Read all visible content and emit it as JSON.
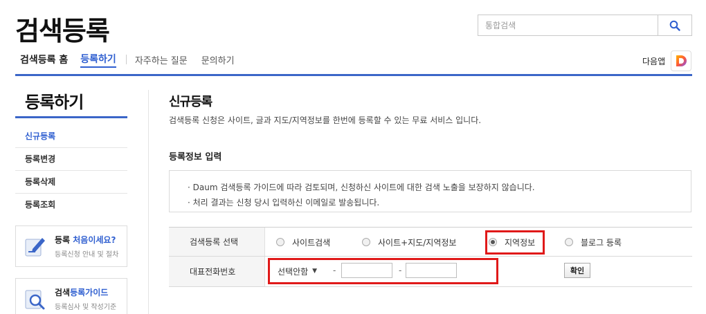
{
  "header": {
    "logo": "검색등록",
    "search_placeholder": "통합검색"
  },
  "gnb": {
    "home": "검색등록 홈",
    "active": "등록하기",
    "items": [
      "자주하는 질문",
      "문의하기"
    ]
  },
  "daum_app": {
    "label": "다음앱"
  },
  "sidebar": {
    "title": "등록하기",
    "items": [
      {
        "label": "신규등록"
      },
      {
        "label": "등록변경"
      },
      {
        "label": "등록삭제"
      },
      {
        "label": "등록조회"
      }
    ],
    "banners": [
      {
        "title_plain": "등록 ",
        "title_highlight": "처음이세요?",
        "desc": "등록신청 안내 및 절차"
      },
      {
        "title_plain": "검색",
        "title_highlight": "등록가이드",
        "desc": "등록심사 및 작성기준"
      }
    ]
  },
  "main": {
    "title": "신규등록",
    "description": "검색등록 신청은 사이트, 글과 지도/지역정보를 한번에 등록할 수 있는 무료 서비스 입니다.",
    "section_title": "등록정보 입력",
    "notices": [
      "· Daum 검색등록 가이드에 따라 검토되며, 신청하신 사이트에 대한 검색 노출을 보장하지 않습니다.",
      "· 처리 결과는 신청 당시 입력하신 이메일로 발송됩니다."
    ],
    "form": {
      "type_label": "검색등록 선택",
      "options": [
        {
          "label": "사이트검색",
          "checked": false
        },
        {
          "label": "사이트+지도/지역정보",
          "checked": false
        },
        {
          "label": "지역정보",
          "checked": true
        },
        {
          "label": "블로그 등록",
          "checked": false
        }
      ],
      "phone_label": "대표전화번호",
      "phone_select": "선택안함",
      "phone_separator": "-",
      "confirm_label": "확인"
    }
  },
  "colors": {
    "accent": "#3b66c8",
    "highlight_box": "#e01919"
  }
}
